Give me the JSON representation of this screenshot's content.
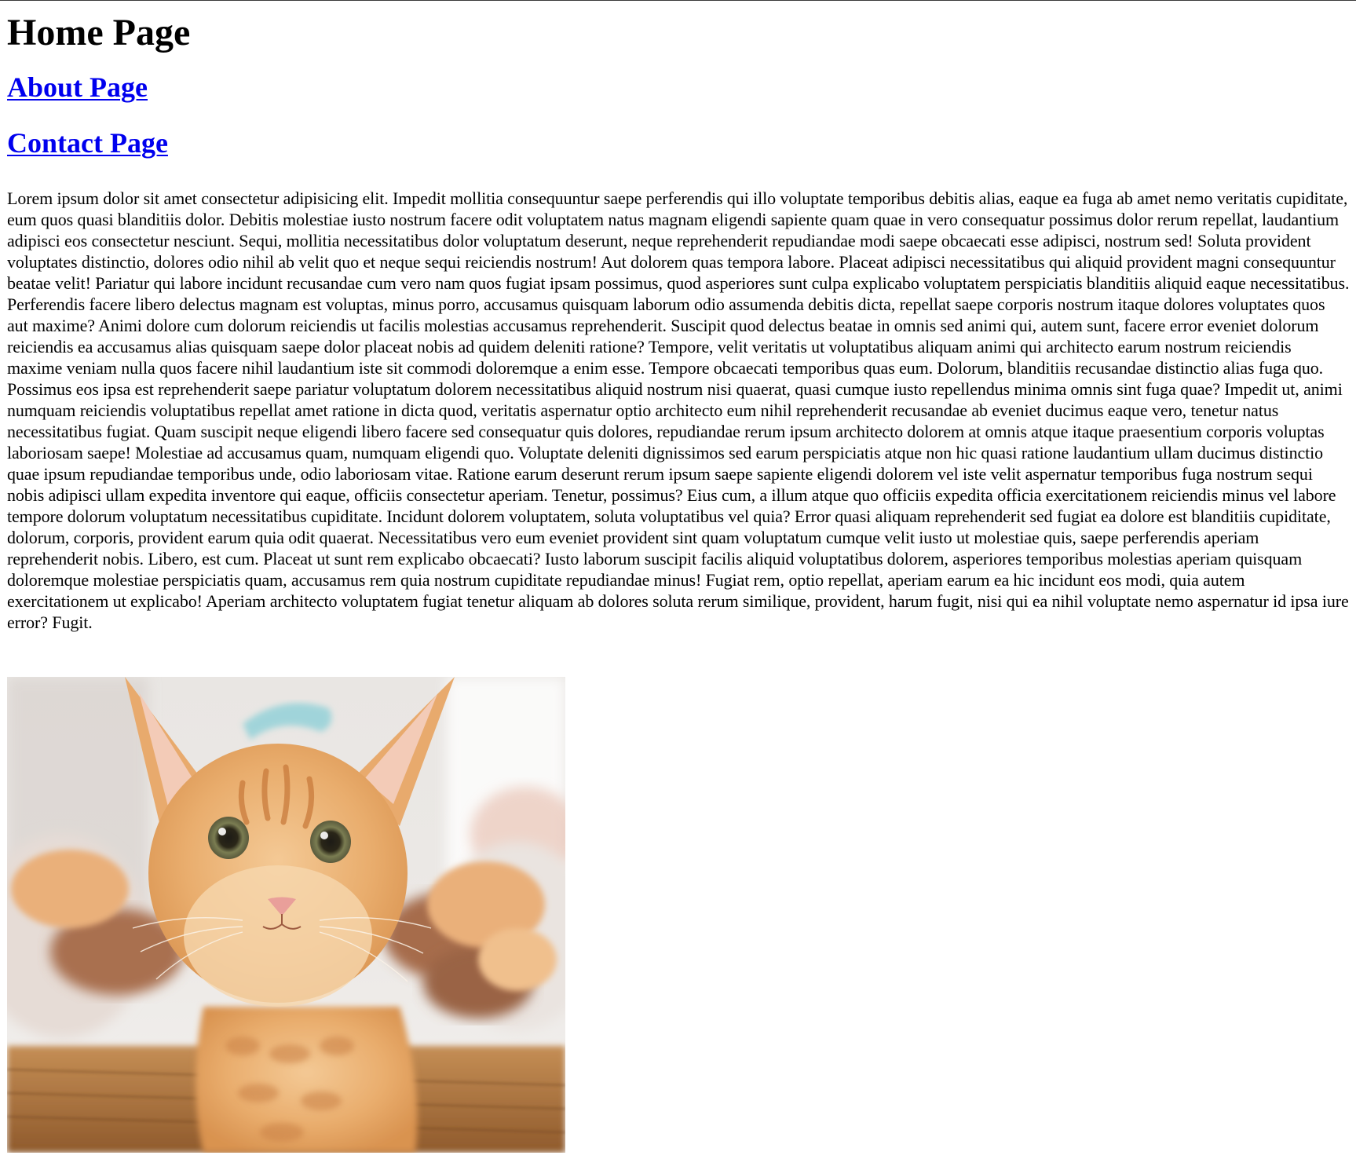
{
  "page": {
    "title": "Home Page",
    "nav": {
      "about_label": "About Page",
      "contact_label": "Contact Page"
    },
    "body_text": "Lorem ipsum dolor sit amet consectetur adipisicing elit. Impedit mollitia consequuntur saepe perferendis qui illo voluptate temporibus debitis alias, eaque ea fuga ab amet nemo veritatis cupiditate, eum quos quasi blanditiis dolor. Debitis molestiae iusto nostrum facere odit voluptatem natus magnam eligendi sapiente quam quae in vero consequatur possimus dolor rerum repellat, laudantium adipisci eos consectetur nesciunt. Sequi, mollitia necessitatibus dolor voluptatum deserunt, neque reprehenderit repudiandae modi saepe obcaecati esse adipisci, nostrum sed! Soluta provident voluptates distinctio, dolores odio nihil ab velit quo et neque sequi reiciendis nostrum! Aut dolorem quas tempora labore. Placeat adipisci necessitatibus qui aliquid provident magni consequuntur beatae velit! Pariatur qui labore incidunt recusandae cum vero nam quos fugiat ipsam possimus, quod asperiores sunt culpa explicabo voluptatem perspiciatis blanditiis aliquid eaque necessitatibus. Perferendis facere libero delectus magnam est voluptas, minus porro, accusamus quisquam laborum odio assumenda debitis dicta, repellat saepe corporis nostrum itaque dolores voluptates quos aut maxime? Animi dolore cum dolorum reiciendis ut facilis molestias accusamus reprehenderit. Suscipit quod delectus beatae in omnis sed animi qui, autem sunt, facere error eveniet dolorum reiciendis ea accusamus alias quisquam saepe dolor placeat nobis ad quidem deleniti ratione? Tempore, velit veritatis ut voluptatibus aliquam animi qui architecto earum nostrum reiciendis maxime veniam nulla quos facere nihil laudantium iste sit commodi doloremque a enim esse. Tempore obcaecati temporibus quas eum. Dolorum, blanditiis recusandae distinctio alias fuga quo. Possimus eos ipsa est reprehenderit saepe pariatur voluptatum dolorem necessitatibus aliquid nostrum nisi quaerat, quasi cumque iusto repellendus minima omnis sint fuga quae? Impedit ut, animi numquam reiciendis voluptatibus repellat amet ratione in dicta quod, veritatis aspernatur optio architecto eum nihil reprehenderit recusandae ab eveniet ducimus eaque vero, tenetur natus necessitatibus fugiat. Quam suscipit neque eligendi libero facere sed consequatur quis dolores, repudiandae rerum ipsum architecto dolorem at omnis atque itaque praesentium corporis voluptas laboriosam saepe! Molestiae ad accusamus quam, numquam eligendi quo. Voluptate deleniti dignissimos sed earum perspiciatis atque non hic quasi ratione laudantium ullam ducimus distinctio quae ipsum repudiandae temporibus unde, odio laboriosam vitae. Ratione earum deserunt rerum ipsum saepe sapiente eligendi dolorem vel iste velit aspernatur temporibus fuga nostrum sequi nobis adipisci ullam expedita inventore qui eaque, officiis consectetur aperiam. Tenetur, possimus? Eius cum, a illum atque quo officiis expedita officia exercitationem reiciendis minus vel labore tempore dolorum voluptatum necessitatibus cupiditate. Incidunt dolorem voluptatem, soluta voluptatibus vel quia? Error quasi aliquam reprehenderit sed fugiat ea dolore est blanditiis cupiditate, dolorum, corporis, provident earum quia odit quaerat. Necessitatibus vero eum eveniet provident sint quam voluptatum cumque velit iusto ut molestiae quis, saepe perferendis aperiam reprehenderit nobis. Libero, est cum. Placeat ut sunt rem explicabo obcaecati? Iusto laborum suscipit facilis aliquid voluptatibus dolorem, asperiores temporibus molestias aperiam quisquam doloremque molestiae perspiciatis quam, accusamus rem quia nostrum cupiditate repudiandae minus! Fugiat rem, optio repellat, aperiam earum ea hic incidunt eos modi, quia autem exercitationem ut explicabo! Aperiam architecto voluptatem fugiat tenetur aliquam ab dolores soluta rerum similique, provident, harum fugit, nisi qui ea nihil voluptate nemo aspernatur id ipsa iure error? Fugit."
  },
  "colors": {
    "link": "#0000ee",
    "text": "#000000",
    "background": "#ffffff"
  }
}
